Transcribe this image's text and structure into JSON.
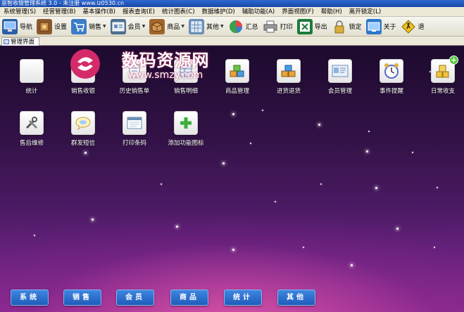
{
  "window": {
    "title": "巫智收银管理系统 3.0 - 未注册 www.iz0530.cn"
  },
  "menu": [
    "系统管理(S)",
    "经营管理(B)",
    "基本操作(B)",
    "报表查询(E)",
    "统计图表(C)",
    "数据维护(D)",
    "辅助功能(A)",
    "界面视图(F)",
    "帮助(H)",
    "离开锁定(L)"
  ],
  "toolbar": [
    {
      "label": "导航",
      "icon": "monitor-icon",
      "color": "#2b5fa8"
    },
    {
      "label": "设置",
      "icon": "settings-box-icon",
      "color": "#8a5a2c"
    },
    {
      "label": "销售",
      "icon": "cart-icon",
      "color": "#3d7cc9",
      "dropdown": true
    },
    {
      "label": "会员",
      "icon": "member-card-icon",
      "color": "#4d6f8f",
      "dropdown": true
    },
    {
      "label": "商品",
      "icon": "goods-box-icon",
      "color": "#a0662b",
      "dropdown": true
    },
    {
      "label": "其他",
      "icon": "grid-icon",
      "color": "#6a8fb8",
      "dropdown": true
    },
    {
      "label": "汇总",
      "icon": "pie-chart-icon",
      "color": "#3aa14a"
    },
    {
      "label": "打印",
      "icon": "printer-icon",
      "color": "#777777"
    },
    {
      "label": "导出",
      "icon": "excel-icon",
      "color": "#1d7a3a"
    },
    {
      "label": "锁定",
      "icon": "lock-icon",
      "color": "#c9a23a"
    },
    {
      "label": "关于",
      "icon": "about-icon",
      "color": "#2d77c8"
    },
    {
      "label": "退",
      "icon": "exit-icon",
      "color": "#d8b020"
    }
  ],
  "tab": {
    "label": "管理界面"
  },
  "watermark": {
    "title": "数码资源网",
    "url": "www.smzy.com"
  },
  "apps_row1": [
    {
      "label": "统计",
      "icon": "stats-icon"
    },
    {
      "label": "销售收银",
      "icon": "cashier-icon"
    },
    {
      "label": "历史销售单",
      "icon": "history-icon"
    },
    {
      "label": "销售明细",
      "icon": "sales-detail-icon"
    },
    {
      "label": "商品管理",
      "icon": "goods-manage-icon"
    },
    {
      "label": "进货退货",
      "icon": "purchase-return-icon"
    },
    {
      "label": "会员管理",
      "icon": "member-manage-icon"
    },
    {
      "label": "事件提醒",
      "icon": "alarm-clock-icon"
    },
    {
      "label": "日常收支",
      "icon": "coins-icon"
    }
  ],
  "apps_row2": [
    {
      "label": "售后维修",
      "icon": "tools-icon"
    },
    {
      "label": "群发短信",
      "icon": "sms-bubble-icon"
    },
    {
      "label": "打印条码",
      "icon": "barcode-window-icon"
    },
    {
      "label": "添加功能图标",
      "icon": "add-plus-icon"
    }
  ],
  "bottom_buttons": [
    "系统",
    "销售",
    "会员",
    "商品",
    "统计",
    "其他"
  ]
}
